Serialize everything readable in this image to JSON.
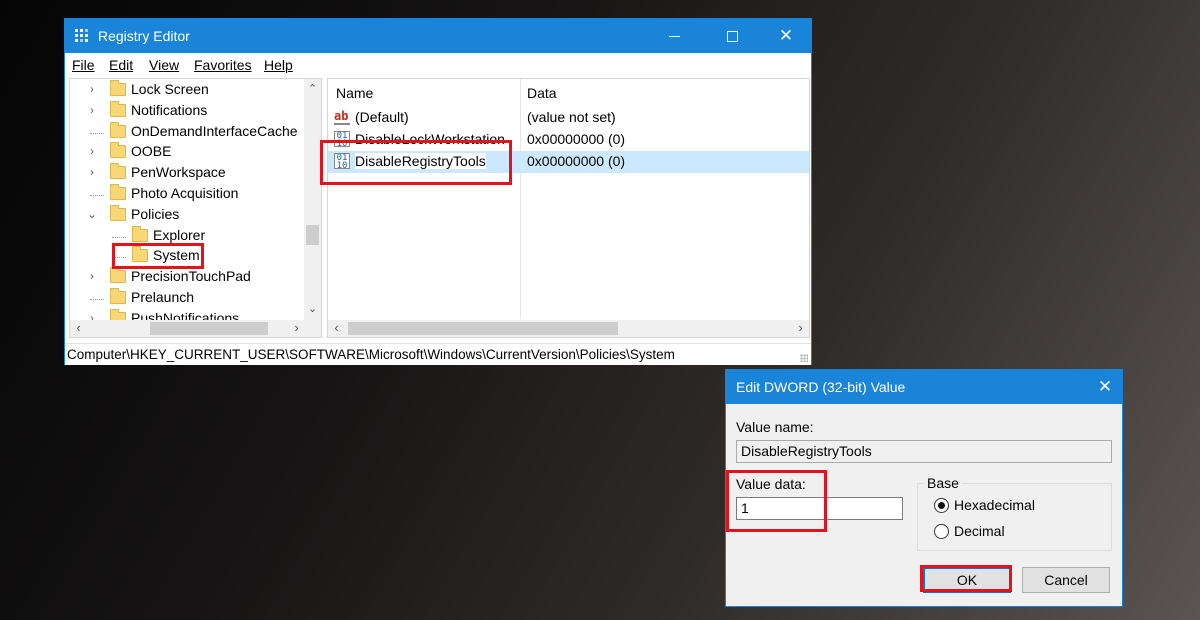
{
  "regedit": {
    "title": "Registry Editor",
    "menu": [
      "File",
      "Edit",
      "View",
      "Favorites",
      "Help"
    ],
    "tree": [
      {
        "label": "Lock Screen",
        "expander": "›"
      },
      {
        "label": "Notifications",
        "expander": "›"
      },
      {
        "label": "OnDemandInterfaceCache",
        "expander": ""
      },
      {
        "label": "OOBE",
        "expander": "›"
      },
      {
        "label": "PenWorkspace",
        "expander": "›"
      },
      {
        "label": "Photo Acquisition",
        "expander": ""
      },
      {
        "label": "Policies",
        "expander": "⌄"
      },
      {
        "label": "Explorer",
        "expander": ""
      },
      {
        "label": "System",
        "expander": ""
      },
      {
        "label": "PrecisionTouchPad",
        "expander": "›"
      },
      {
        "label": "Prelaunch",
        "expander": ""
      },
      {
        "label": "PushNotifications",
        "expander": "›"
      }
    ],
    "columns": {
      "name": "Name",
      "data": "Data"
    },
    "values": [
      {
        "name": "(Default)",
        "data": "(value not set)",
        "icon": "string-value-icon"
      },
      {
        "name": "DisableLockWorkstation",
        "data": "0x00000000 (0)",
        "icon": "dword-value-icon"
      },
      {
        "name": "DisableRegistryTools",
        "data": "0x00000000 (0)",
        "icon": "dword-value-icon"
      }
    ],
    "status_path": "Computer\\HKEY_CURRENT_USER\\SOFTWARE\\Microsoft\\Windows\\CurrentVersion\\Policies\\System"
  },
  "dialog": {
    "title": "Edit DWORD (32-bit) Value",
    "value_name_label": "Value name:",
    "value_name": "DisableRegistryTools",
    "value_data_label": "Value data:",
    "value_data": "1",
    "base_label": "Base",
    "base_options": [
      "Hexadecimal",
      "Decimal"
    ],
    "selected_base": "Hexadecimal",
    "ok_label": "OK",
    "cancel_label": "Cancel"
  },
  "colors": {
    "titlebar": "#1a85d8",
    "highlight": "#e0141e",
    "selection": "#cce8ff"
  }
}
